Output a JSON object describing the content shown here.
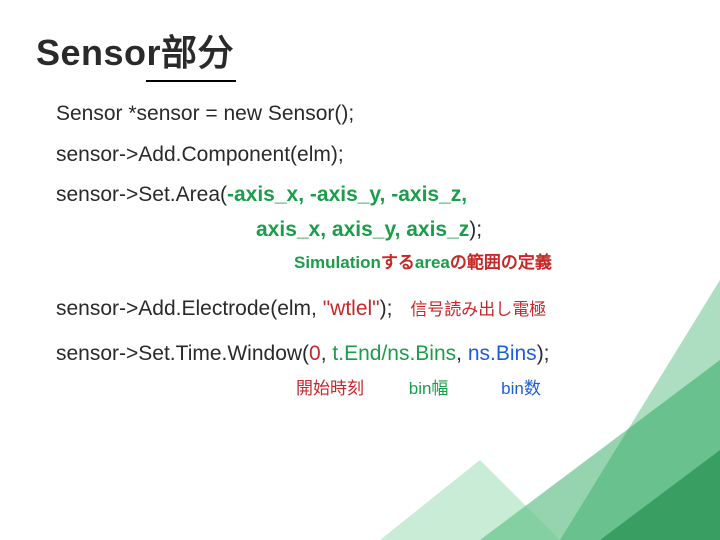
{
  "title": "Sensor部分",
  "lines": {
    "l1": "Sensor *sensor = new Sensor();",
    "l2": "sensor->Add.Component(elm);",
    "l3_pre": "sensor->Set.Area(",
    "l3_args": "-axis_x, -axis_y, -axis_z,",
    "l4_args": "axis_x, axis_y, axis_z",
    "l4_close": ");",
    "anno_area_pre": "Simulation",
    "anno_area_mid": "する",
    "anno_area_mid2": "area",
    "anno_area_post": "の範囲の定義",
    "l5_pre": "sensor->Add.Electrode(elm, ",
    "l5_arg": "\"wtlel\"",
    "l5_close": ");",
    "anno_elec": "信号読み出し電極",
    "l6_pre": "sensor->Set.Time.Window(",
    "l6_a1": "0",
    "l6_sep1": ", ",
    "l6_a2": "t.End/ns.Bins",
    "l6_sep2": ", ",
    "l6_a3": "ns.Bins",
    "l6_close": ");",
    "lbl_start": "開始時刻",
    "lbl_binw": "bin幅",
    "lbl_bins": "bin数"
  }
}
